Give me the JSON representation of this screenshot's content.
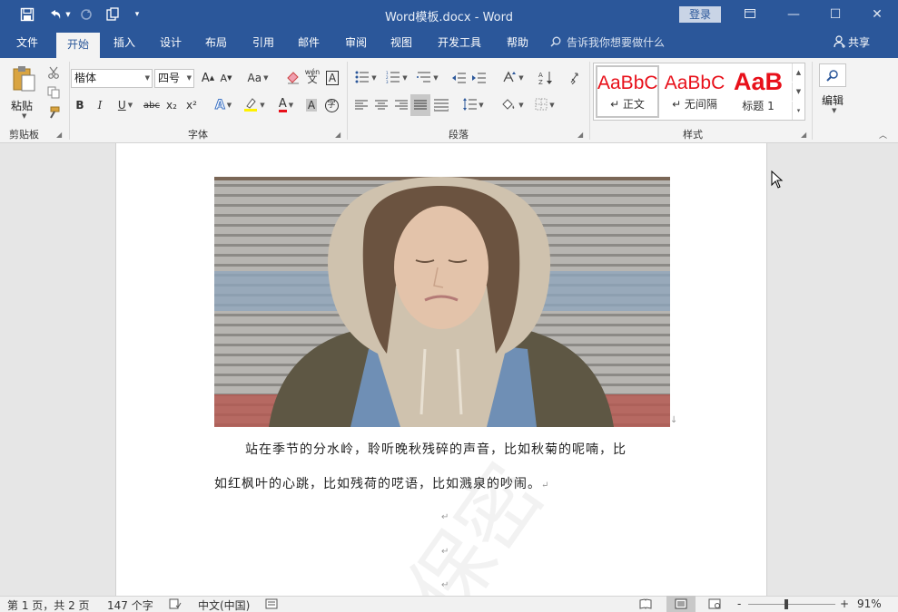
{
  "titlebar": {
    "title": "Word模板.docx  -  Word",
    "login_label": "登录"
  },
  "tabs": [
    {
      "label": "文件"
    },
    {
      "label": "开始"
    },
    {
      "label": "插入"
    },
    {
      "label": "设计"
    },
    {
      "label": "布局"
    },
    {
      "label": "引用"
    },
    {
      "label": "邮件"
    },
    {
      "label": "审阅"
    },
    {
      "label": "视图"
    },
    {
      "label": "开发工具"
    },
    {
      "label": "帮助"
    }
  ],
  "tellme": {
    "placeholder": "告诉我你想要做什么"
  },
  "share_label": "共享",
  "ribbon": {
    "clipboard": {
      "paste_label": "粘贴",
      "group_label": "剪贴板"
    },
    "font": {
      "font_name": "楷体",
      "font_size": "四号",
      "group_label": "字体",
      "case_label": "Aa",
      "bold": "B",
      "italic": "I",
      "underline": "U",
      "strike": "abc",
      "subscript": "x₂",
      "superscript": "x²",
      "grow": "A",
      "shrink": "A",
      "phonetic_label": "wén",
      "border_char": "A",
      "shade_char": "A",
      "enclose_char": "字"
    },
    "paragraph": {
      "group_label": "段落"
    },
    "styles": {
      "group_label": "样式",
      "items": [
        {
          "preview": "AaBbC",
          "name": "↵ 正文"
        },
        {
          "preview": "AaBbC",
          "name": "↵ 无间隔"
        },
        {
          "preview": "AaB",
          "name": "标题 1"
        }
      ]
    },
    "editing": {
      "label": "编辑"
    }
  },
  "document": {
    "para1_line1": "站在季节的分水岭，聆听晚秋残碎的声音，比如秋菊的呢喃，比",
    "para1_line2": "如红枫叶的心跳，比如残荷的呓语，比如溅泉的吵闹。",
    "return_mark": "↵",
    "image_anchor_mark": "↓",
    "watermark": "保密"
  },
  "statusbar": {
    "page": "第 1 页，共 2 页",
    "words": "147 个字",
    "language": "中文(中国)",
    "zoom": "91%",
    "zoom_minus": "-",
    "zoom_plus": "+",
    "zoom_level": 0.91
  },
  "colors": {
    "titlebar": "#2b579a",
    "ribbon": "#f3f3f3",
    "style_red": "#e8101a"
  }
}
